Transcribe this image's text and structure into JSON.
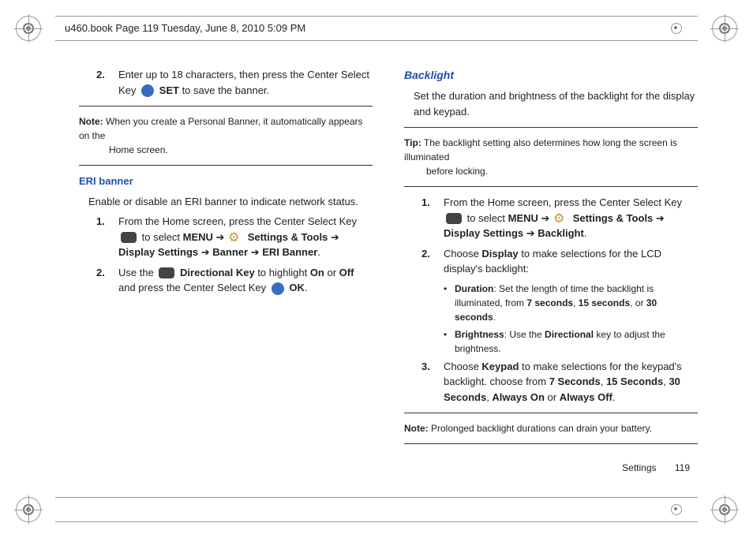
{
  "printer_header": "u460.book  Page 119  Tuesday, June 8, 2010  5:09 PM",
  "left": {
    "step2_num": "2.",
    "step2_a": "Enter up to 18 characters, then press the Center Select Key",
    "step2_b": "SET",
    "step2_c": " to save the banner.",
    "note_lbl": "Note:",
    "note_a": " When you create a Personal Banner, it automatically appears on the",
    "note_b": "Home screen.",
    "heading": "ERI banner",
    "intro": "Enable or disable an ERI banner to indicate network status.",
    "eri1_num": "1.",
    "eri1_a": "From the Home screen, press the Center Select Key ",
    "eri1_b": "to select ",
    "eri1_menu": "MENU",
    "eri1_arrow1": " ➔ ",
    "eri1_settings": "Settings & Tools",
    "eri1_arrow2": " ➔ ",
    "eri1_display": "Display Settings",
    "eri1_arrow3": " ➔ ",
    "eri1_banner": "Banner",
    "eri1_arrow4": " ➔ ",
    "eri1_eri": "ERI Banner",
    "eri1_period": ".",
    "eri2_num": "2.",
    "eri2_a": "Use the ",
    "eri2_dir": "Directional Key",
    "eri2_b": " to highlight ",
    "eri2_on": "On",
    "eri2_or": " or ",
    "eri2_off": "Off",
    "eri2_c": " and press the Center Select Key ",
    "eri2_ok": "OK",
    "eri2_period": "."
  },
  "right": {
    "heading": "Backlight",
    "intro": "Set the duration and brightness of the backlight for the display and keypad.",
    "tip_lbl": "Tip:",
    "tip_a": " The backlight setting also determines how long the screen is illuminated",
    "tip_b": "before locking.",
    "bl1_num": "1.",
    "bl1_a": "From the Home screen, press the Center Select Key ",
    "bl1_b": "to select ",
    "bl1_menu": "MENU",
    "bl1_arrow1": " ➔ ",
    "bl1_settings": "Settings & Tools",
    "bl1_arrow2": " ➔ ",
    "bl1_display": "Display Settings",
    "bl1_arrow3": " ➔ ",
    "bl1_backlight": "Backlight",
    "bl1_period": ".",
    "bl2_num": "2.",
    "bl2_a": "Choose ",
    "bl2_disp": "Display",
    "bl2_b": " to make selections for the LCD display's backlight:",
    "bul1_lbl": "Duration",
    "bul1_a": ": Set the length of time the backlight is illuminated, from ",
    "bul1_7": "7 seconds",
    "bul1_c1": ", ",
    "bul1_15": "15 seconds",
    "bul1_c2": ", or ",
    "bul1_30": "30 seconds",
    "bul1_p": ".",
    "bul2_lbl": "Brightness",
    "bul2_a": ": Use the ",
    "bul2_dir": "Directional",
    "bul2_b": " key to adjust the brightness.",
    "bl3_num": "3.",
    "bl3_a": "Choose ",
    "bl3_kp": "Keypad",
    "bl3_b": " to make selections for the keypad's backlight. choose from ",
    "bl3_7": "7 Seconds",
    "bl3_c1": ", ",
    "bl3_15": "15 Seconds",
    "bl3_c2": ", ",
    "bl3_30": "30 Seconds",
    "bl3_c3": ", ",
    "bl3_on": "Always On",
    "bl3_or": " or ",
    "bl3_off": "Always Off",
    "bl3_p": ".",
    "note_lbl": "Note:",
    "note_a": " Prolonged backlight durations can drain your battery."
  },
  "footer": {
    "section": "Settings",
    "page": "119"
  }
}
